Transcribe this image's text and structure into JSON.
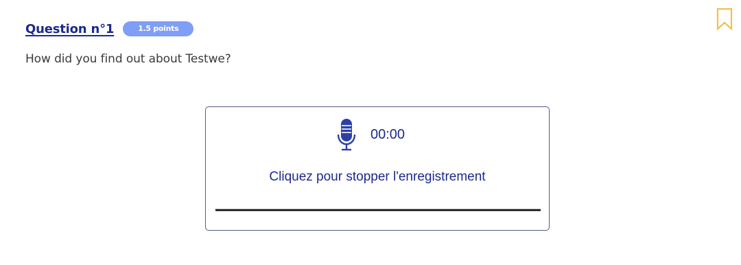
{
  "question": {
    "title": "Question n°1",
    "points_badge": "1.5 points",
    "text": "How did you find out about Testwe?"
  },
  "recorder": {
    "timer": "00:00",
    "instruction": "Cliquez pour stopper l'enregistrement",
    "icon": "microphone-icon",
    "state": "recording"
  },
  "bookmark": {
    "icon": "bookmark-icon",
    "color": "#f2c04a"
  },
  "colors": {
    "primary": "#1a2a8f",
    "badge": "#7f9ef5",
    "mic": "#2d3fa8"
  }
}
